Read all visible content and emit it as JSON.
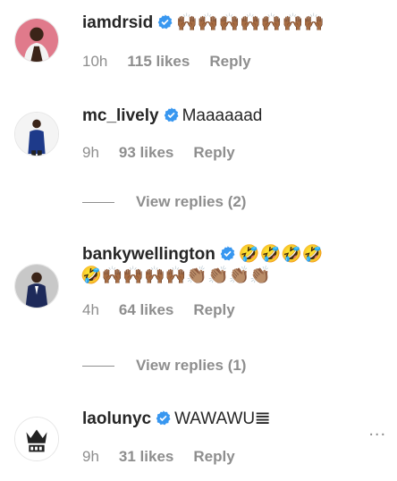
{
  "comments": [
    {
      "username": "iamdrsid",
      "text": "🙌🏾🙌🏾🙌🏾🙌🏾🙌🏾🙌🏾🙌🏾",
      "time": "10h",
      "likes": "115 likes",
      "reply": "Reply"
    },
    {
      "username": "mc_lively",
      "text": "Maaaaaad",
      "time": "9h",
      "likes": "93 likes",
      "reply": "Reply",
      "view_replies": "View replies (2)"
    },
    {
      "username": "bankywellington",
      "text": "🤣🤣🤣🤣",
      "text_line2": "🤣🙌🏾🙌🏾🙌🏾🙌🏾👏🏽👏🏽👏🏽👏🏽",
      "time": "4h",
      "likes": "64 likes",
      "reply": "Reply",
      "view_replies": "View replies (1)"
    },
    {
      "username": "laolunyc",
      "text": "WAWAWU𝌆",
      "time": "9h",
      "likes": "31 likes",
      "reply": "Reply",
      "more": "..."
    }
  ],
  "colors": {
    "verified_blue": "#3897f0",
    "meta_gray": "#8e8e8e",
    "text": "#262626"
  }
}
